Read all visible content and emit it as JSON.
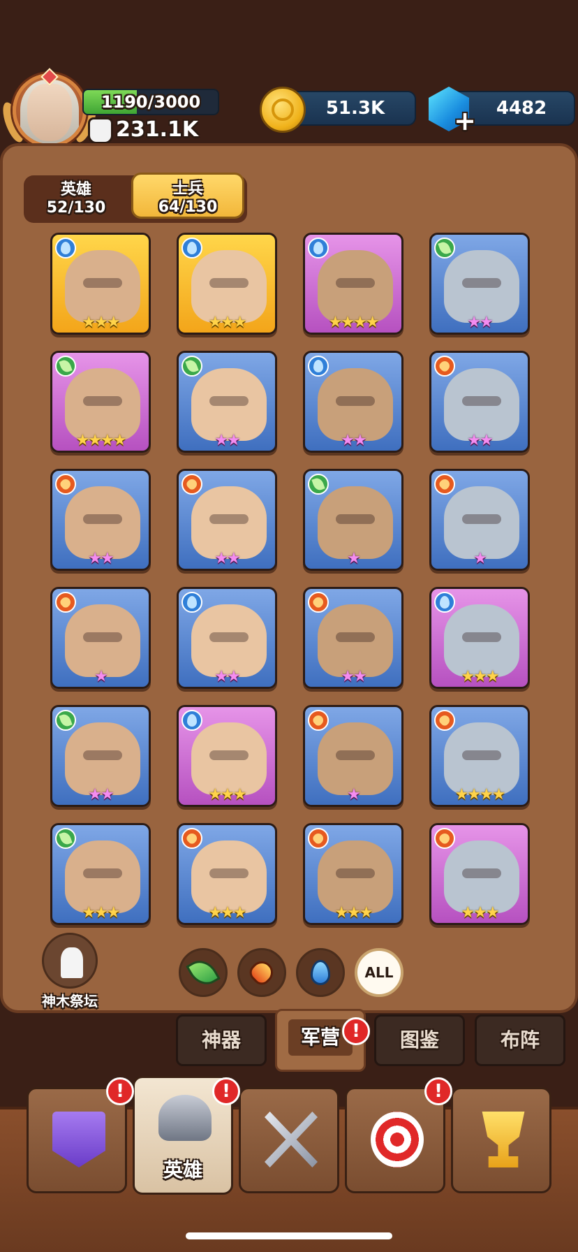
{
  "player": {
    "xp_text": "1190/3000",
    "xp_fraction": 0.397,
    "power": "231.1K"
  },
  "resources": {
    "coins": "51.3K",
    "gems": "4482",
    "gem_plus": "+"
  },
  "roster_tabs": [
    {
      "label": "英雄",
      "count": "52/130",
      "active": false
    },
    {
      "label": "士兵",
      "count": "64/130",
      "active": true
    }
  ],
  "cards": [
    {
      "element": "water",
      "bg": "yellow",
      "stars": 3,
      "star_color": "gold"
    },
    {
      "element": "water",
      "bg": "yellow",
      "stars": 3,
      "star_color": "gold"
    },
    {
      "element": "water",
      "bg": "pink",
      "stars": 4,
      "star_color": "gold"
    },
    {
      "element": "leaf",
      "bg": "blue",
      "stars": 2,
      "star_color": "pink"
    },
    {
      "element": "leaf",
      "bg": "pink",
      "stars": 4,
      "star_color": "gold"
    },
    {
      "element": "leaf",
      "bg": "blue",
      "stars": 2,
      "star_color": "pink"
    },
    {
      "element": "water",
      "bg": "blue",
      "stars": 2,
      "star_color": "pink"
    },
    {
      "element": "fire",
      "bg": "blue",
      "stars": 2,
      "star_color": "pink"
    },
    {
      "element": "fire",
      "bg": "blue",
      "stars": 2,
      "star_color": "pink"
    },
    {
      "element": "fire",
      "bg": "blue",
      "stars": 2,
      "star_color": "pink"
    },
    {
      "element": "leaf",
      "bg": "blue",
      "stars": 1,
      "star_color": "pink"
    },
    {
      "element": "fire",
      "bg": "blue",
      "stars": 1,
      "star_color": "pink"
    },
    {
      "element": "fire",
      "bg": "blue",
      "stars": 1,
      "star_color": "pink"
    },
    {
      "element": "water",
      "bg": "blue",
      "stars": 2,
      "star_color": "pink"
    },
    {
      "element": "fire",
      "bg": "blue",
      "stars": 2,
      "star_color": "pink"
    },
    {
      "element": "water",
      "bg": "pink",
      "stars": 3,
      "star_color": "gold"
    },
    {
      "element": "leaf",
      "bg": "blue",
      "stars": 2,
      "star_color": "pink"
    },
    {
      "element": "water",
      "bg": "pink",
      "stars": 3,
      "star_color": "gold"
    },
    {
      "element": "fire",
      "bg": "blue",
      "stars": 1,
      "star_color": "pink"
    },
    {
      "element": "fire",
      "bg": "blue",
      "stars": 4,
      "star_color": "gold"
    },
    {
      "element": "leaf",
      "bg": "blue",
      "stars": 3,
      "star_color": "gold"
    },
    {
      "element": "fire",
      "bg": "blue",
      "stars": 3,
      "star_color": "gold"
    },
    {
      "element": "fire",
      "bg": "blue",
      "stars": 3,
      "star_color": "gold"
    },
    {
      "element": "fire",
      "bg": "pink",
      "stars": 3,
      "star_color": "gold"
    }
  ],
  "altar": {
    "label": "神木祭坛"
  },
  "filters": [
    {
      "name": "leaf"
    },
    {
      "name": "fire"
    },
    {
      "name": "water"
    },
    {
      "name": "all",
      "label": "ALL"
    }
  ],
  "sub_tabs": [
    {
      "label": "神器",
      "active": false,
      "alert": false
    },
    {
      "label": "军营",
      "active": true,
      "alert": true
    },
    {
      "label": "图鉴",
      "active": false,
      "alert": false
    },
    {
      "label": "布阵",
      "active": false,
      "alert": false
    }
  ],
  "bottom_nav": [
    {
      "icon": "banner-sword-icon",
      "label": "",
      "alert": true,
      "active": false
    },
    {
      "icon": "viking-helmet-icon",
      "label": "英雄",
      "alert": true,
      "active": true
    },
    {
      "icon": "crossed-swords-icon",
      "label": "",
      "alert": false,
      "active": false
    },
    {
      "icon": "target-arrow-icon",
      "label": "",
      "alert": true,
      "active": false
    },
    {
      "icon": "trophy-icon",
      "label": "",
      "alert": false,
      "active": false
    }
  ],
  "badge_text": "!",
  "colors": {
    "panel": "#99643f",
    "gold_tab": "#f2b73a",
    "alert": "#e02828"
  }
}
